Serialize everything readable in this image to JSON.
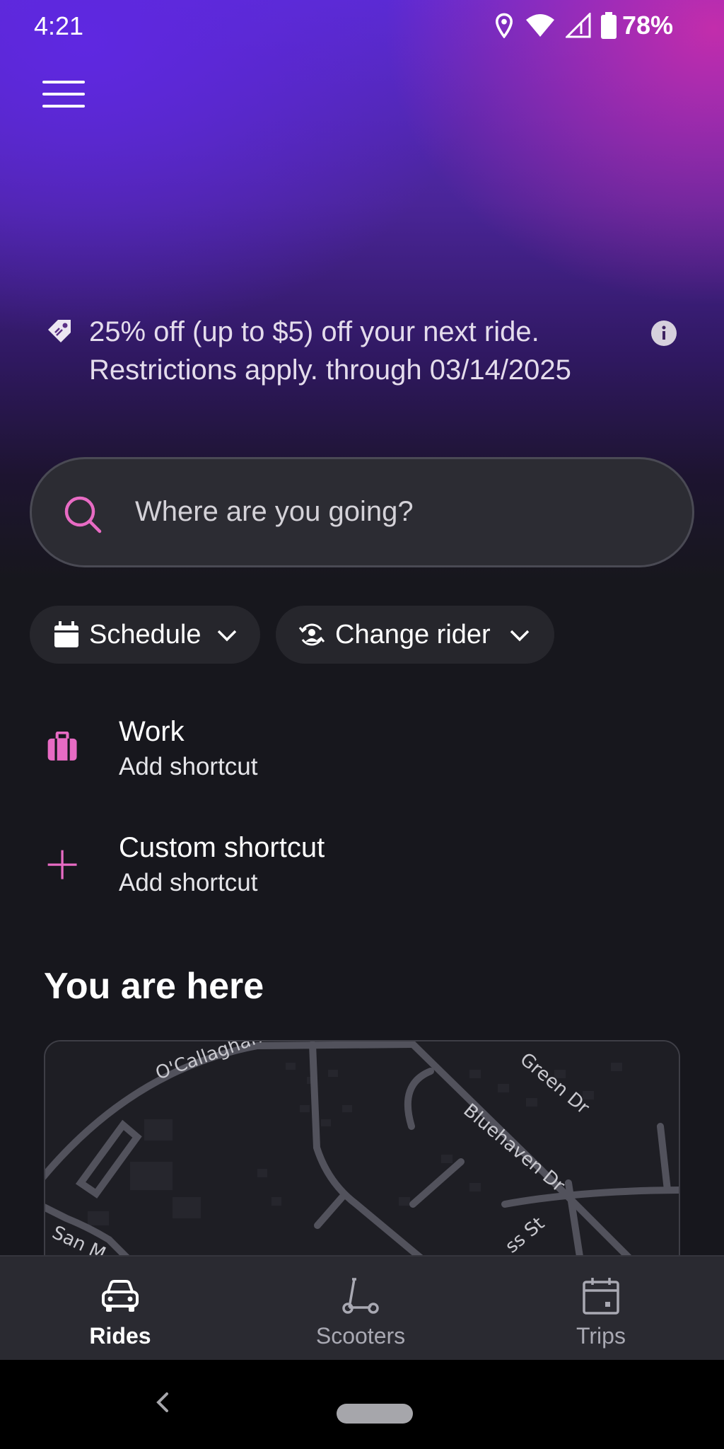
{
  "status_bar": {
    "time": "4:21",
    "battery": "78%"
  },
  "promo": {
    "text": "25% off (up to $5) off your next ride. Restrictions apply. through 03/14/2025"
  },
  "search": {
    "placeholder": "Where are you going?"
  },
  "chips": {
    "schedule": "Schedule",
    "change_rider": "Change rider"
  },
  "shortcuts": [
    {
      "title": "Work",
      "subtitle": "Add shortcut",
      "icon": "briefcase-icon"
    },
    {
      "title": "Custom shortcut",
      "subtitle": "Add shortcut",
      "icon": "plus-icon"
    }
  ],
  "location_section": {
    "title": "You are here",
    "map_labels": [
      "O'Callaghan Dr",
      "Bluehaven Dr",
      "Green Dr",
      "San M",
      "ss St"
    ]
  },
  "bottom_nav": [
    {
      "label": "Rides",
      "icon": "car-icon",
      "active": true
    },
    {
      "label": "Scooters",
      "icon": "scooter-icon",
      "active": false
    },
    {
      "label": "Trips",
      "icon": "calendar-icon",
      "active": false
    }
  ],
  "colors": {
    "accent": "#e86bc4",
    "background": "#17171d",
    "surface": "#2c2c33"
  }
}
